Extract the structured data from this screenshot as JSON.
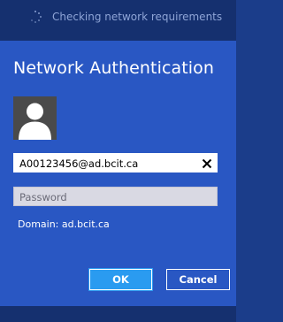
{
  "status": {
    "text": "Checking network requirements"
  },
  "dialog": {
    "title": "Network Authentication",
    "username_value": "A00123456@ad.bcit.ca",
    "password_placeholder": "Password",
    "domain_text": "Domain: ad.bcit.ca",
    "ok_label": "OK",
    "cancel_label": "Cancel"
  },
  "icons": {
    "spinner": "loading-spinner-icon",
    "avatar": "user-silhouette-icon",
    "clear": "close-x-icon"
  },
  "colors": {
    "background": "#1b3d8a",
    "dialog_bg": "#2957c3",
    "ok_button": "#2a9bf0",
    "status_text": "#8ea4d6"
  }
}
